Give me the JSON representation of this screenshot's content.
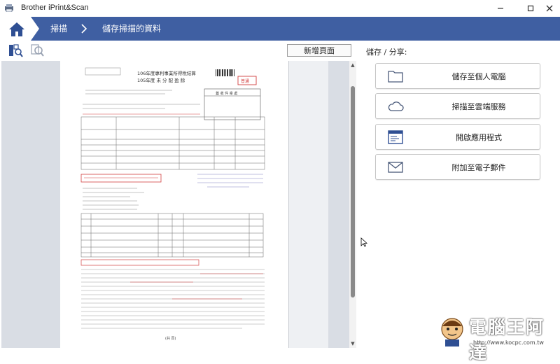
{
  "window": {
    "title": "Brother iPrint&Scan"
  },
  "nav": {
    "home_icon": "home-icon",
    "crumbs": [
      {
        "label": "掃描"
      },
      {
        "label": "儲存掃描的資料"
      }
    ]
  },
  "toolbar": {
    "add_page_label": "新增頁面"
  },
  "share": {
    "title": "儲存 / 分享:",
    "actions": [
      {
        "label": "儲存至個人電腦",
        "icon": "folder-icon"
      },
      {
        "label": "掃描至雲端服務",
        "icon": "cloud-icon"
      },
      {
        "label": "開啟應用程式",
        "icon": "app-window-icon"
      },
      {
        "label": "附加至電子郵件",
        "icon": "envelope-icon"
      }
    ]
  },
  "document": {
    "heading_line1": "106年度專利事業所得稅結算",
    "heading_line2": "105年度 未 分 配 盈 餘",
    "stamp": "普通",
    "box_title": "蓋 收 件 章 處",
    "footer": "(共 頁)"
  },
  "watermark": {
    "text": "電腦王阿達",
    "url": "http://www.kocpc.com.tw"
  },
  "colors": {
    "nav_bg": "#3f5fa2",
    "preview_bg": "#d9dde4"
  }
}
